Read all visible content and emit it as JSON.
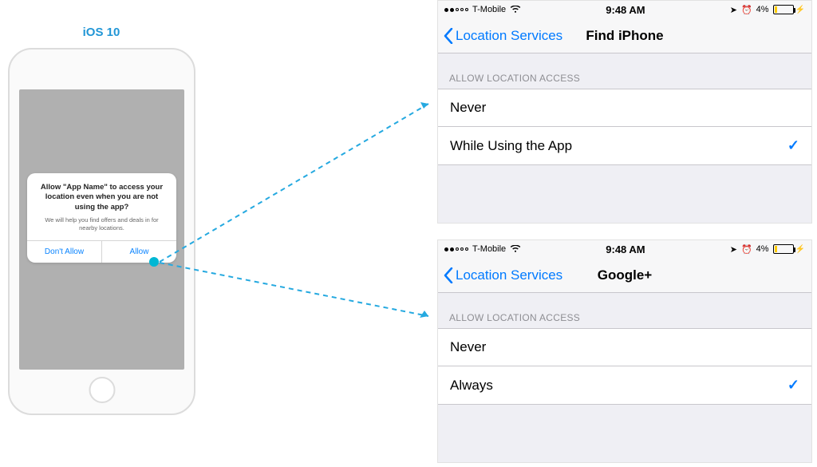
{
  "label": "iOS 10",
  "dialog": {
    "title": "Allow \"App Name\" to access your location even when you are not using the app?",
    "subtitle": "We will help you find offers and deals in for nearby locations.",
    "dont_allow": "Don't Allow",
    "allow": "Allow"
  },
  "status_bar": {
    "carrier": "T-Mobile",
    "time": "9:48 AM",
    "battery_pct": "4%"
  },
  "nav": {
    "back_label": "Location Services",
    "section_header": "ALLOW LOCATION ACCESS"
  },
  "screens": [
    {
      "title": "Find iPhone",
      "options": [
        {
          "label": "Never",
          "selected": false
        },
        {
          "label": "While Using the App",
          "selected": true
        }
      ]
    },
    {
      "title": "Google+",
      "options": [
        {
          "label": "Never",
          "selected": false
        },
        {
          "label": "Always",
          "selected": true
        }
      ]
    }
  ]
}
